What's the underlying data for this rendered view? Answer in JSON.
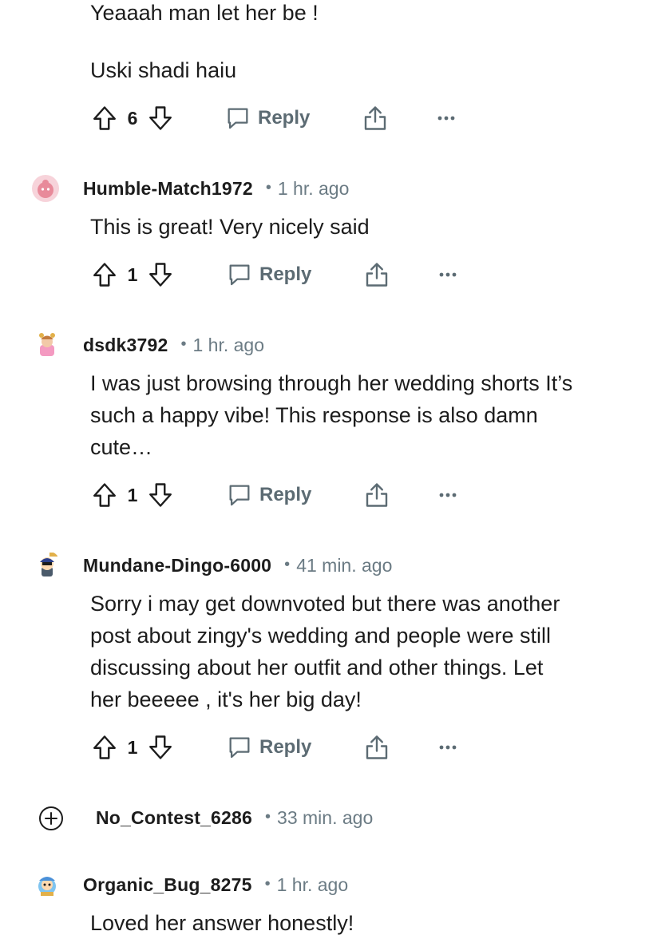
{
  "comments": [
    {
      "lines": [
        "Yeaaah man let her be !",
        "",
        "Uski shadi haiu"
      ],
      "votes": "6",
      "reply_label": "Reply"
    },
    {
      "username": "Humble-Match1972",
      "time": "1 hr. ago",
      "avatar_color": "#e88a9a",
      "lines": [
        "This is great! Very nicely said"
      ],
      "votes": "1",
      "reply_label": "Reply"
    },
    {
      "username": "dsdk3792",
      "time": "1 hr. ago",
      "avatar_color": "#f2b9a6",
      "lines": [
        "I was just browsing through her wedding shorts It’s",
        "such a happy vibe! This response is also damn",
        "cute…"
      ],
      "votes": "1",
      "reply_label": "Reply"
    },
    {
      "username": "Mundane-Dingo-6000",
      "time": "41 min. ago",
      "avatar_color": "#3a4a8c",
      "lines": [
        "Sorry i may get downvoted but there was another",
        "post about zingy's wedding and people were still",
        "discussing about her outfit and other things. Let",
        "her beeeee , it's her big day!"
      ],
      "votes": "1",
      "reply_label": "Reply"
    },
    {
      "username": "No_Contest_6286",
      "time": "33 min. ago",
      "collapsed": true
    },
    {
      "username": "Organic_Bug_8275",
      "time": "1 hr. ago",
      "avatar_color": "#4a90d9",
      "lines": [
        "Loved her answer honestly!"
      ]
    }
  ],
  "icons": {
    "upvote": "arrow-up-outline-icon",
    "downvote": "arrow-down-outline-icon",
    "reply": "speech-bubble-icon",
    "share": "share-icon",
    "more": "ellipsis-icon",
    "expand": "plus-circle-icon"
  },
  "colors": {
    "meta_text": "#6b7b84",
    "icon_stroke": "#5c6b73",
    "body_text": "#1c1c1c"
  }
}
